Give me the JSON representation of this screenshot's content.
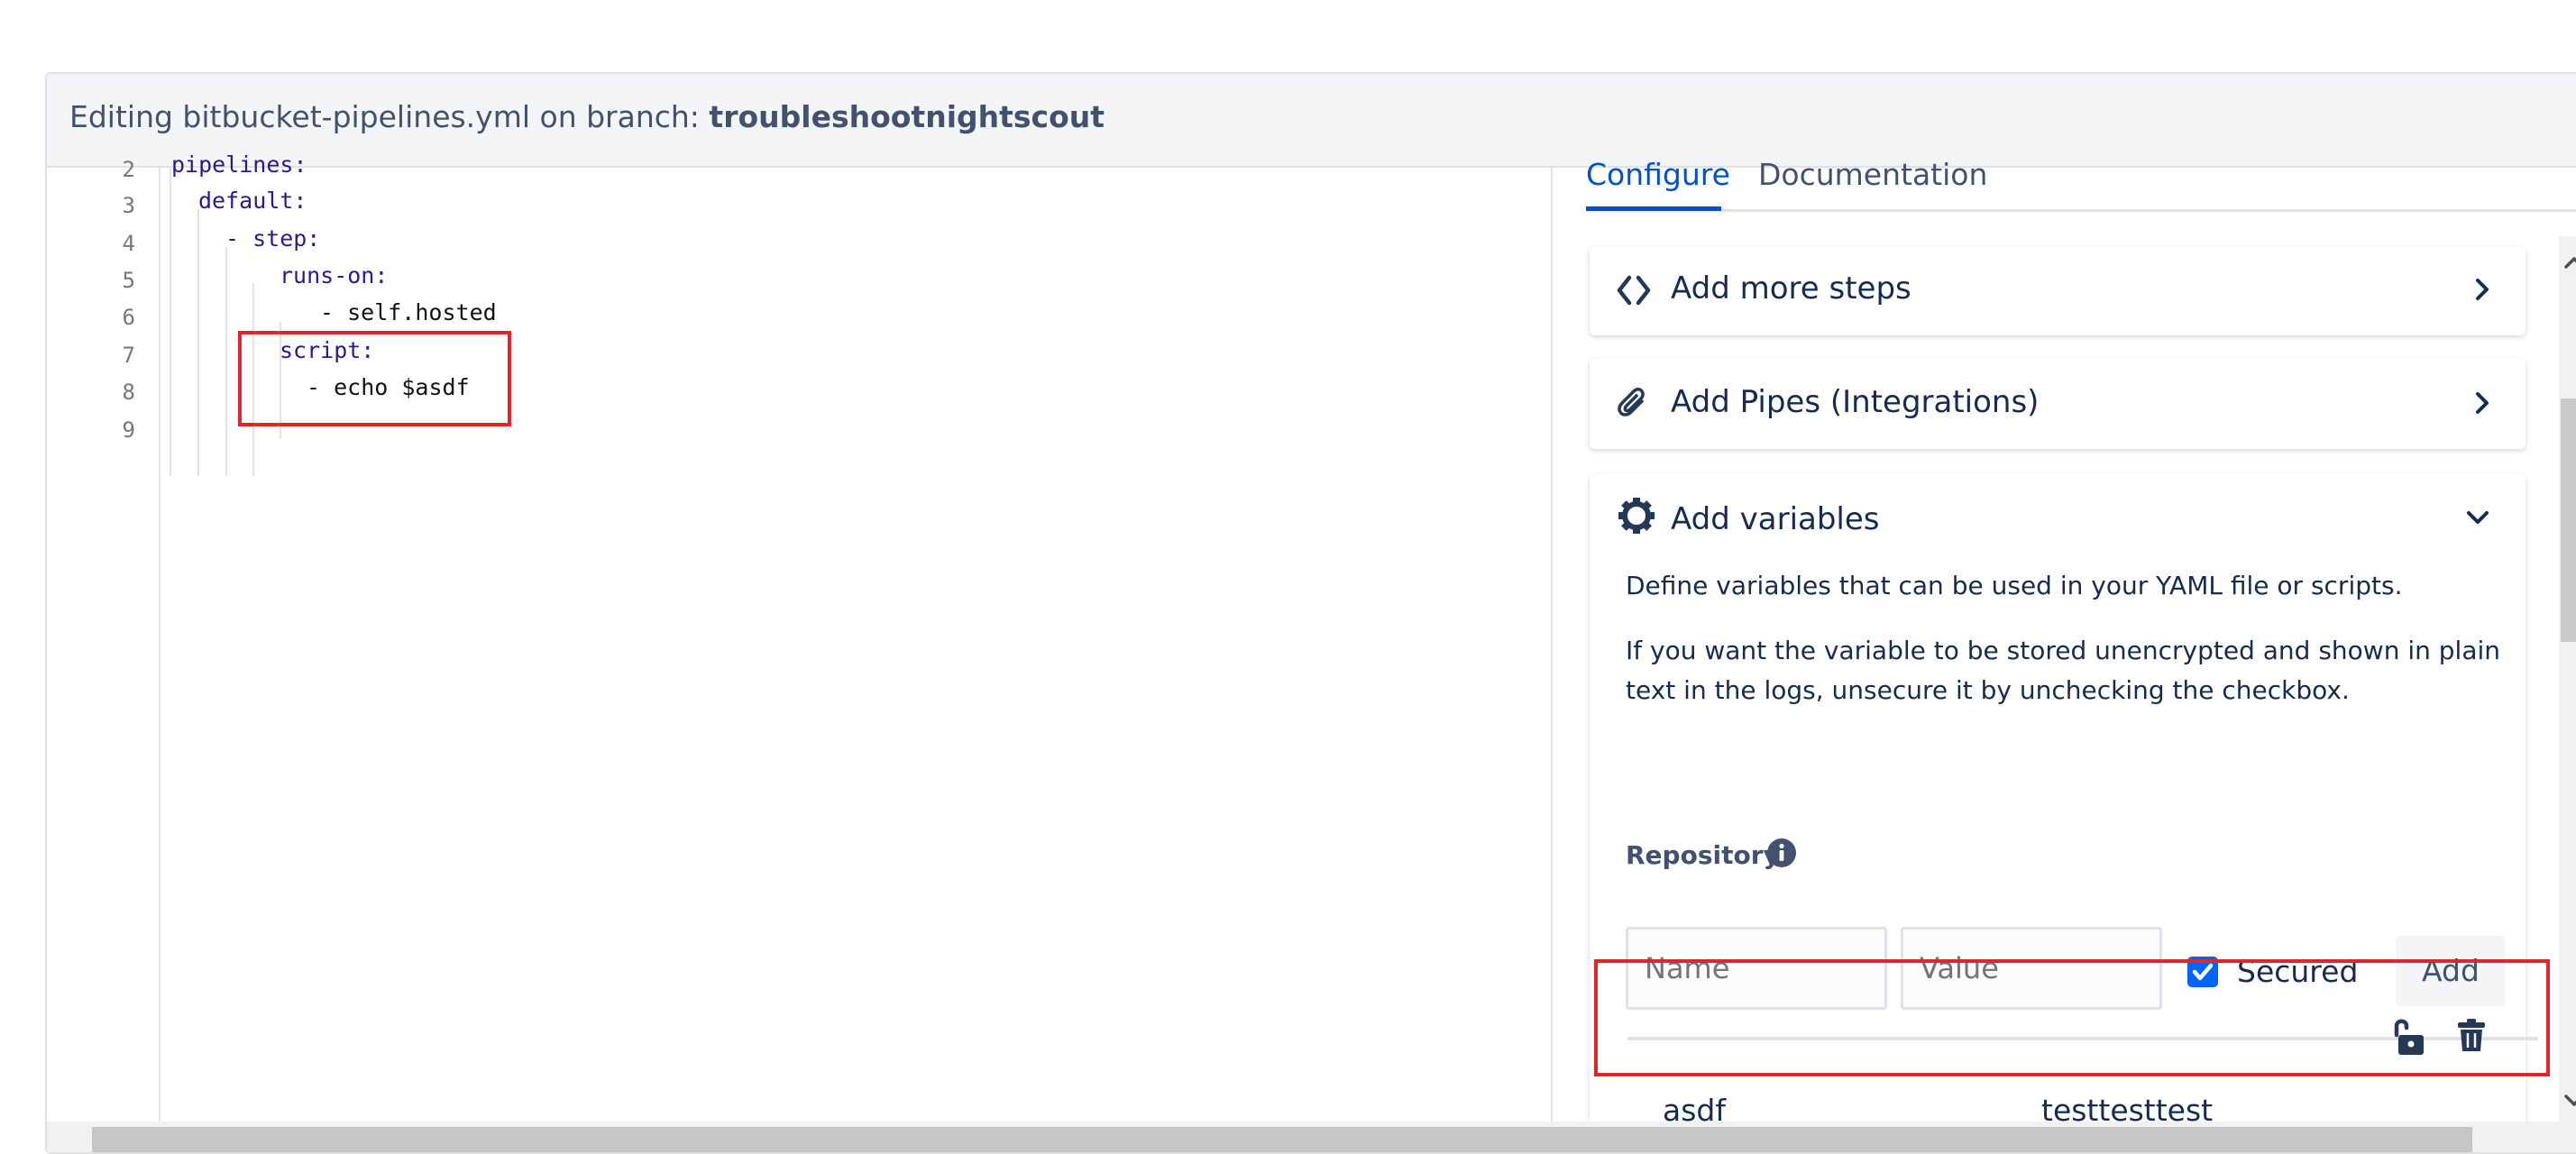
{
  "header": {
    "prefix": "Editing bitbucket-pipelines.yml on branch: ",
    "branch": "troubleshootnightscout"
  },
  "editor": {
    "lines": [
      {
        "num": "2",
        "text": "pipelines:"
      },
      {
        "num": "3",
        "text": "default:"
      },
      {
        "num": "4",
        "text": "- step:"
      },
      {
        "num": "5",
        "text": "runs-on:"
      },
      {
        "num": "6",
        "text": "- self.hosted"
      },
      {
        "num": "7",
        "text": "script:"
      },
      {
        "num": "8",
        "text": "- echo $asdf"
      },
      {
        "num": "9",
        "text": ""
      }
    ]
  },
  "tabs": {
    "configure": "Configure",
    "documentation": "Documentation"
  },
  "cards": {
    "steps": "Add more steps",
    "pipes": "Add Pipes (Integrations)",
    "variables": "Add variables"
  },
  "variables": {
    "desc1": "Define variables that can be used in your YAML file or scripts.",
    "desc2": "If you want the variable to be stored unencrypted and shown in plain text in the logs, unsecure it by unchecking the checkbox.",
    "repository_label": "Repository",
    "name_placeholder": "Name",
    "value_placeholder": "Value",
    "secured_label": "Secured",
    "add_label": "Add",
    "rows": [
      {
        "name": "asdf",
        "value": "testtesttest"
      }
    ]
  },
  "colors": {
    "accent": "#0052cc",
    "highlight": "#e0252c",
    "checkbox": "#0065ff"
  }
}
